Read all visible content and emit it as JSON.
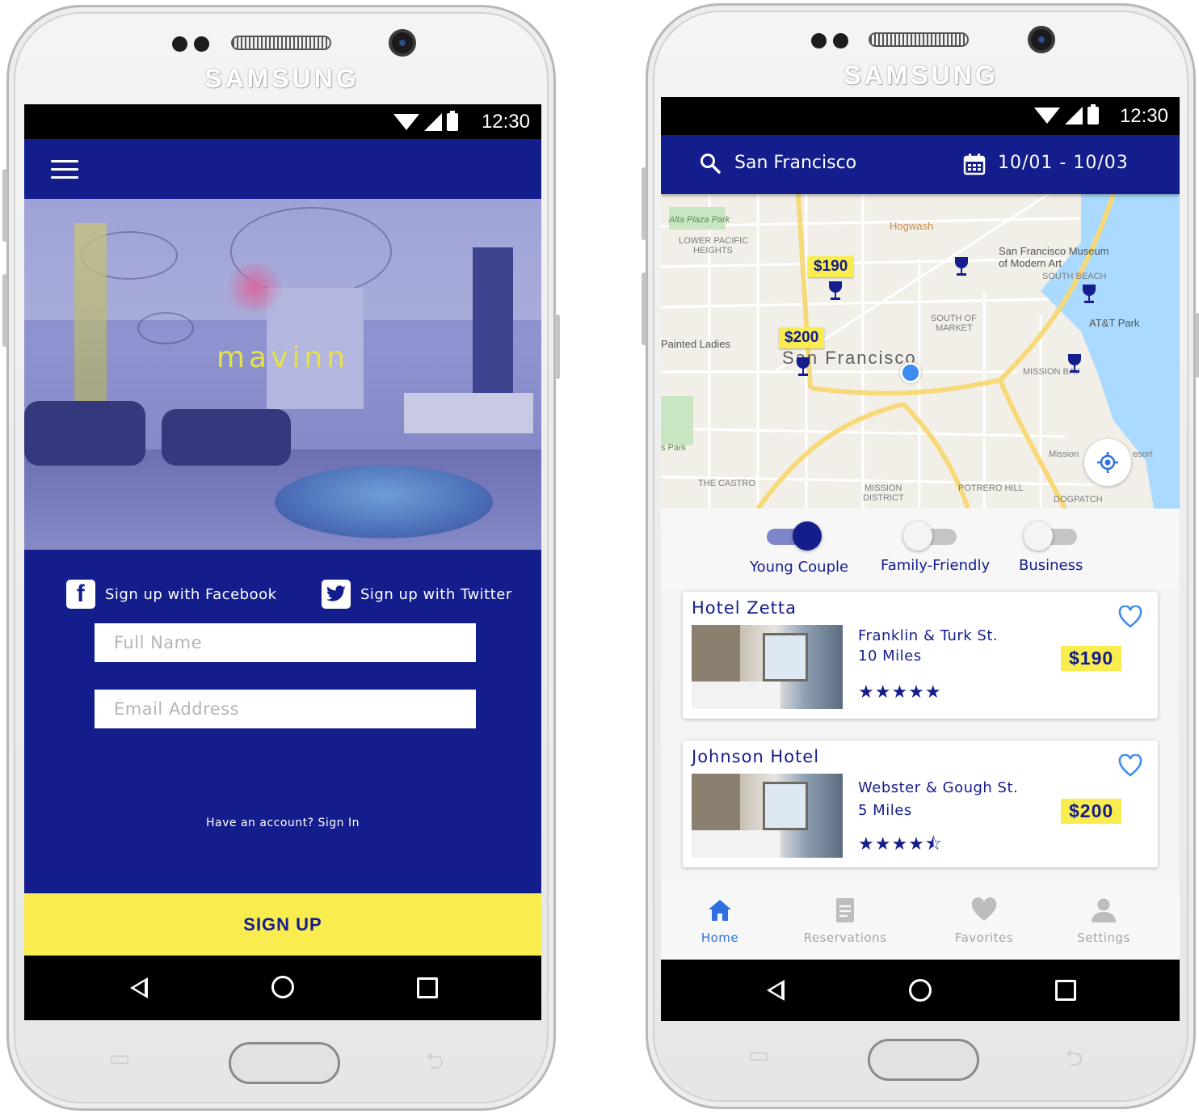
{
  "left_phone": {
    "brand": "SAMSUNG",
    "status_time": "12:30",
    "app_name": "mavinn",
    "social": {
      "facebook_label": "Sign up with Facebook",
      "twitter_label": "Sign up with Twitter"
    },
    "form": {
      "full_name_placeholder": "Full Name",
      "email_placeholder": "Email Address",
      "signin_link": "Have an account? Sign In",
      "signup_button": "SIGN UP"
    },
    "colors": {
      "primary": "#141d8c",
      "accent": "#f9ec4f"
    }
  },
  "right_phone": {
    "brand": "SAMSUNG",
    "status_time": "12:30",
    "search": {
      "city": "San Francisco",
      "dates": "10/01 - 10/03"
    },
    "map": {
      "labels": {
        "alta_plaza": "Alta Plaza Park",
        "lower_pacific": "LOWER PACIFIC",
        "heights": "HEIGHTS",
        "hogwash": "Hogwash",
        "sfmoma_1": "San Francisco Museum",
        "sfmoma_2": "of Modern Art",
        "south_beach": "SOUTH BEACH",
        "south_of": "SOUTH OF",
        "market": "MARKET",
        "att_park": "AT&T Park",
        "painted_ladies": "Painted Ladies",
        "city_name": "San Francisco",
        "mission_bay": "MISSION BAY",
        "the_castro": "THE CASTRO",
        "mission_district_1": "MISSION",
        "mission_district_2": "DISTRICT",
        "potrero_hill": "POTRERO HILL",
        "dogpatch": "DOGPATCH",
        "twin_peaks": "s Park",
        "mission_resort": "Mission",
        "resort_suffix": "esort"
      },
      "price_tags": [
        "$190",
        "$200"
      ]
    },
    "filters": [
      {
        "label": "Young Couple",
        "on": true
      },
      {
        "label": "Family-Friendly",
        "on": false
      },
      {
        "label": "Business",
        "on": false
      }
    ],
    "hotels": [
      {
        "name": "Hotel Zetta",
        "address": "Franklin & Turk St.",
        "distance": "10 Miles",
        "stars": "★★★★★",
        "rating": 5,
        "price": "$190"
      },
      {
        "name": "Johnson Hotel",
        "address": "Webster & Gough St.",
        "distance": "5 Miles",
        "stars": "★★★★⯪",
        "rating": 4.5,
        "price": "$200"
      }
    ],
    "tabs": [
      {
        "label": "Home",
        "icon": "home-icon",
        "active": true
      },
      {
        "label": "Reservations",
        "icon": "reservations-icon",
        "active": false
      },
      {
        "label": "Favorites",
        "icon": "heart-icon",
        "active": false
      },
      {
        "label": "Settings",
        "icon": "person-icon",
        "active": false
      }
    ],
    "colors": {
      "primary": "#141d8c",
      "accent": "#f9ec4f",
      "active_tab": "#2f6fe0"
    }
  }
}
